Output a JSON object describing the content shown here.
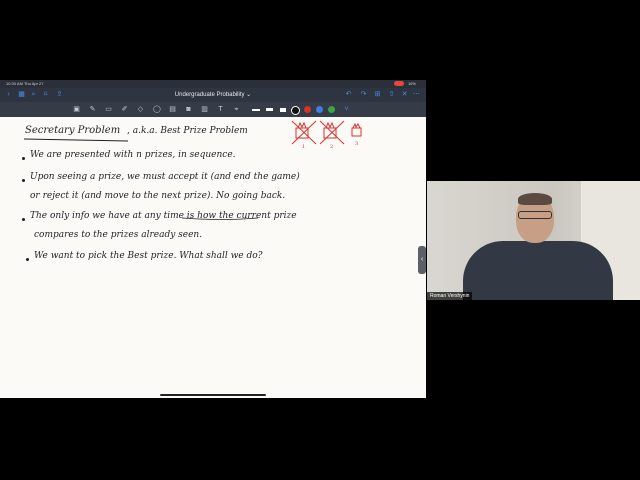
{
  "status": {
    "time": "10:30 AM Thu Apr 27",
    "battery": "16%"
  },
  "navbar": {
    "title": "Undergraduate Probability ⌄"
  },
  "note": {
    "heading_title": "Secretary Problem",
    "heading_aka": ", a.k.a.  Best Prize Problem",
    "bullets": [
      "We are presented with  n  prizes,  in sequence.",
      "Upon seeing a prize,  we must accept it  (and end the game)",
      "or reject it  (and move to the next prize).  No going back.",
      "The only info we have at any time is how the current prize",
      "compares to the prizes already seen.",
      "We want to pick the Best prize.   What shall we do?"
    ],
    "prize_labels": [
      "1",
      "2",
      "3"
    ]
  },
  "video": {
    "name": "Roman Vershynin"
  },
  "colors": {
    "ink": "#1f1f28",
    "red": "#d9312b",
    "accent": "#4d8bf0"
  }
}
